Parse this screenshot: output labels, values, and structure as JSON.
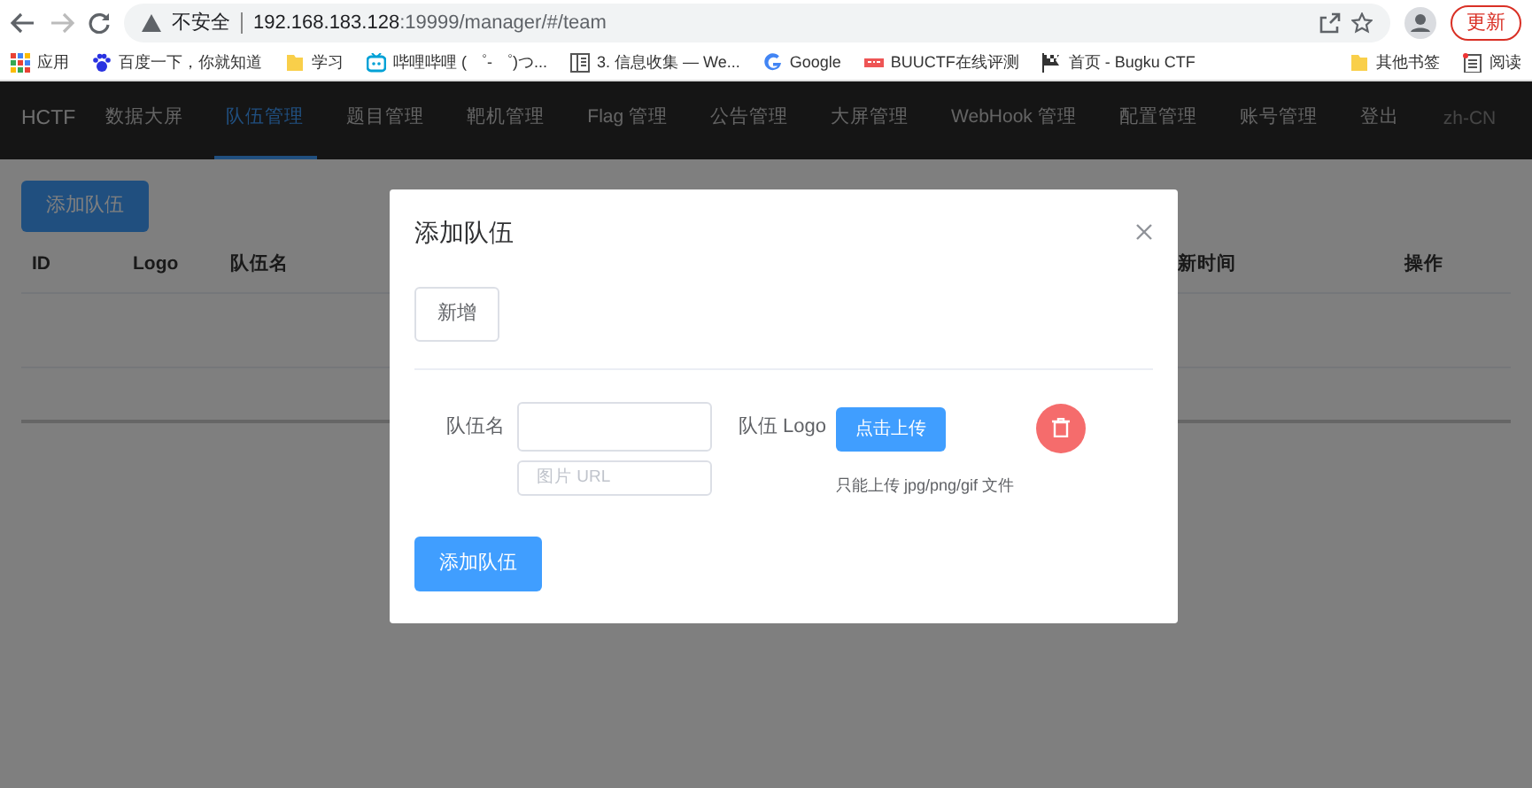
{
  "browser": {
    "insecure_label": "不安全",
    "url_host": "192.168.183.128",
    "url_rest": ":19999/manager/#/team",
    "update_button": "更新",
    "bookmarks": [
      {
        "kind": "apps",
        "label": "应用"
      },
      {
        "kind": "paw",
        "label": "百度一下，你就知道"
      },
      {
        "kind": "folder",
        "label": "学习"
      },
      {
        "kind": "tv",
        "label": "哔哩哔哩 ( ゜- ゜)つ..."
      },
      {
        "kind": "book",
        "label": "3. 信息收集 — We..."
      },
      {
        "kind": "google",
        "label": "Google"
      },
      {
        "kind": "tag",
        "label": "BUUCTF在线评测"
      },
      {
        "kind": "flag",
        "label": "首页 - Bugku CTF"
      }
    ],
    "other_bookmarks": "其他书签",
    "reading_list": "阅读"
  },
  "nav": {
    "brand": "HCTF",
    "items": [
      {
        "label": "数据大屏",
        "selected": false
      },
      {
        "label": "队伍管理",
        "selected": true
      },
      {
        "label": "题目管理",
        "selected": false
      },
      {
        "label": "靶机管理",
        "selected": false
      },
      {
        "label": "Flag 管理",
        "selected": false
      },
      {
        "label": "公告管理",
        "selected": false
      },
      {
        "label": "大屏管理",
        "selected": false
      },
      {
        "label": "WebHook 管理",
        "selected": false
      },
      {
        "label": "配置管理",
        "selected": false
      },
      {
        "label": "账号管理",
        "selected": false
      },
      {
        "label": "登出",
        "selected": false
      }
    ],
    "language": "zh-CN"
  },
  "page": {
    "add_button": "添加队伍",
    "table": {
      "columns": [
        "ID",
        "Logo",
        "队伍名",
        "新时间",
        "操作"
      ]
    }
  },
  "modal": {
    "title": "添加队伍",
    "new_button": "新增",
    "name_label": "队伍名",
    "url_placeholder": "图片 URL",
    "logo_label": "队伍 Logo",
    "upload_button": "点击上传",
    "upload_hint": "只能上传 jpg/png/gif 文件",
    "submit_button": "添加队伍"
  }
}
